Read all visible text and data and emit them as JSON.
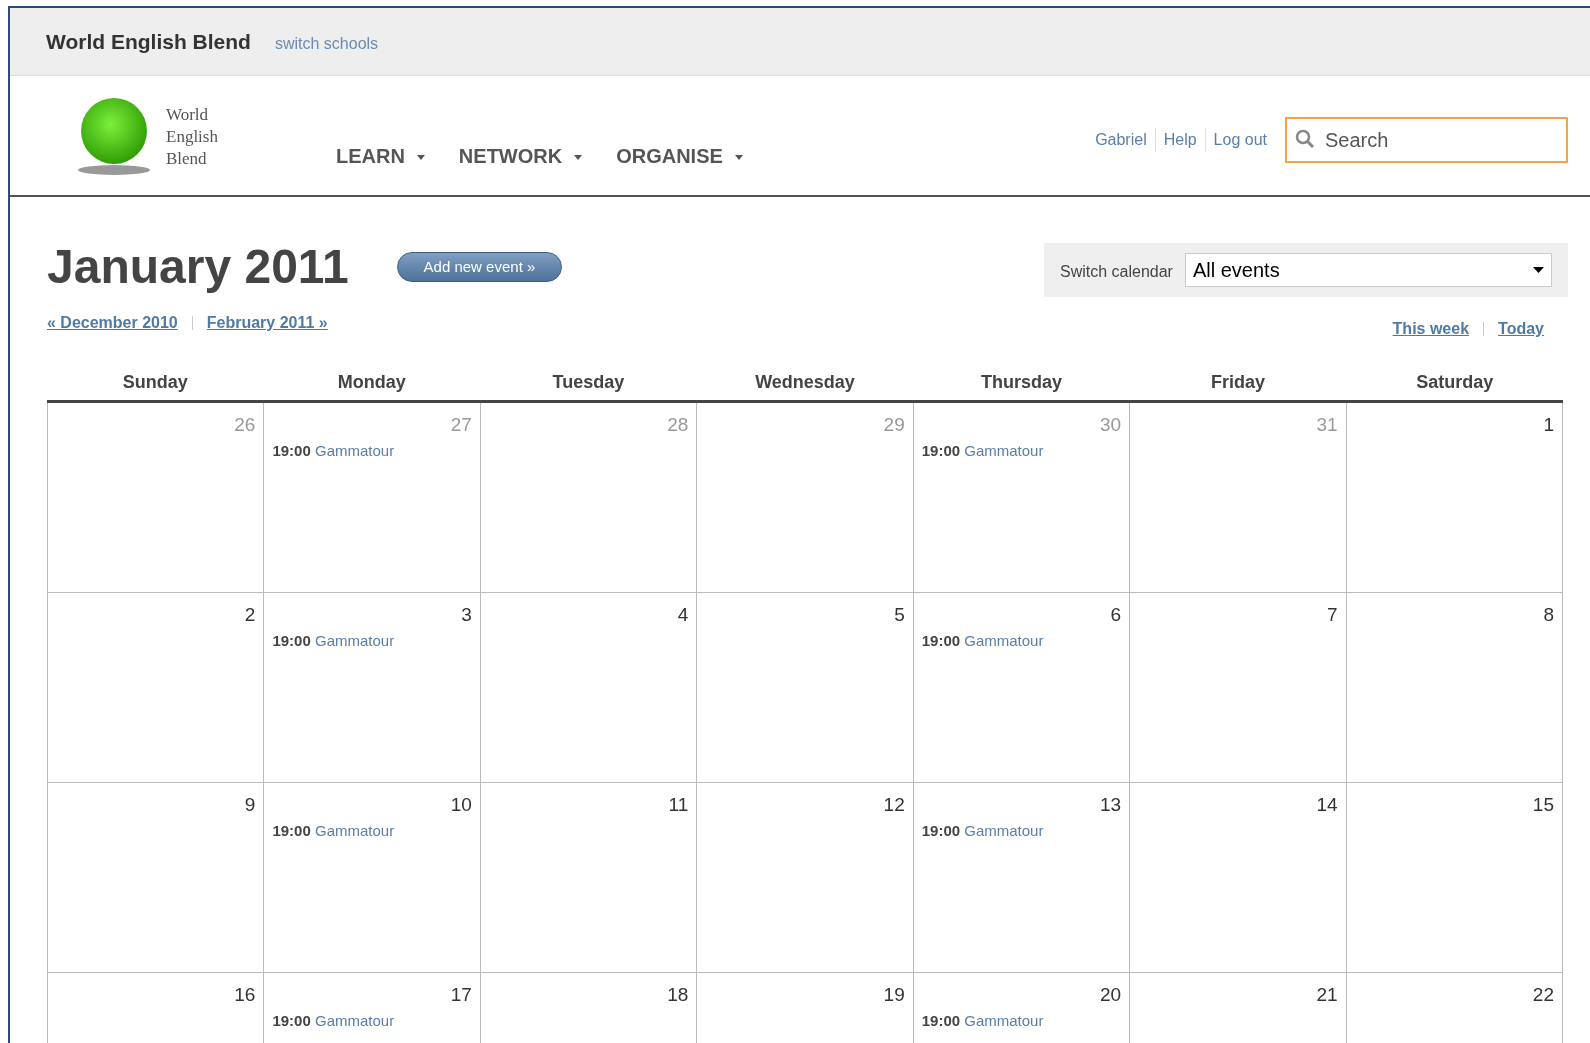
{
  "topbar": {
    "school": "World English Blend",
    "switch_link": "switch schools"
  },
  "logo": {
    "lines": [
      "World",
      "English",
      "Blend"
    ]
  },
  "nav": [
    {
      "label": "LEARN"
    },
    {
      "label": "NETWORK"
    },
    {
      "label": "ORGANISE"
    }
  ],
  "user_links": [
    "Gabriel",
    "Help",
    "Log out"
  ],
  "search": {
    "placeholder": "Search"
  },
  "title": "January 2011",
  "add_button": "Add new event »",
  "prev_link": "« December 2010",
  "next_link": "February 2011 »",
  "switch_calendar": {
    "label": "Switch calendar",
    "value": "All events"
  },
  "quick_links": [
    "This week",
    "Today"
  ],
  "weekdays": [
    "Sunday",
    "Monday",
    "Tuesday",
    "Wednesday",
    "Thursday",
    "Friday",
    "Saturday"
  ],
  "weeks": [
    [
      {
        "day": "26",
        "muted": true
      },
      {
        "day": "27",
        "muted": true,
        "events": [
          {
            "time": "19:00",
            "title": "Gammatour"
          }
        ]
      },
      {
        "day": "28",
        "muted": true
      },
      {
        "day": "29",
        "muted": true
      },
      {
        "day": "30",
        "muted": true,
        "events": [
          {
            "time": "19:00",
            "title": "Gammatour"
          }
        ]
      },
      {
        "day": "31",
        "muted": true
      },
      {
        "day": "1",
        "muted": false
      }
    ],
    [
      {
        "day": "2",
        "muted": false
      },
      {
        "day": "3",
        "muted": false,
        "events": [
          {
            "time": "19:00",
            "title": "Gammatour"
          }
        ]
      },
      {
        "day": "4",
        "muted": false
      },
      {
        "day": "5",
        "muted": false
      },
      {
        "day": "6",
        "muted": false,
        "events": [
          {
            "time": "19:00",
            "title": "Gammatour"
          }
        ]
      },
      {
        "day": "7",
        "muted": false
      },
      {
        "day": "8",
        "muted": false
      }
    ],
    [
      {
        "day": "9",
        "muted": false
      },
      {
        "day": "10",
        "muted": false,
        "events": [
          {
            "time": "19:00",
            "title": "Gammatour"
          }
        ]
      },
      {
        "day": "11",
        "muted": false
      },
      {
        "day": "12",
        "muted": false
      },
      {
        "day": "13",
        "muted": false,
        "events": [
          {
            "time": "19:00",
            "title": "Gammatour"
          }
        ]
      },
      {
        "day": "14",
        "muted": false
      },
      {
        "day": "15",
        "muted": false
      }
    ],
    [
      {
        "day": "16",
        "muted": false
      },
      {
        "day": "17",
        "muted": false,
        "events": [
          {
            "time": "19:00",
            "title": "Gammatour"
          }
        ]
      },
      {
        "day": "18",
        "muted": false
      },
      {
        "day": "19",
        "muted": false
      },
      {
        "day": "20",
        "muted": false,
        "events": [
          {
            "time": "19:00",
            "title": "Gammatour"
          }
        ]
      },
      {
        "day": "21",
        "muted": false
      },
      {
        "day": "22",
        "muted": false
      }
    ]
  ]
}
